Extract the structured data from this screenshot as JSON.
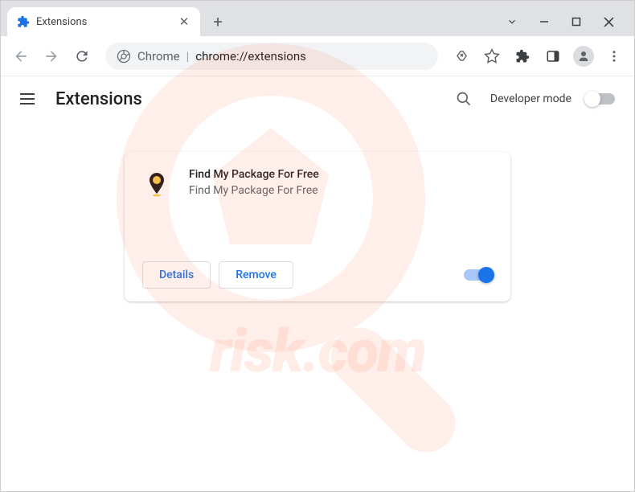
{
  "tab": {
    "title": "Extensions"
  },
  "url": {
    "prefix": "Chrome",
    "path": "chrome://extensions"
  },
  "header": {
    "title": "Extensions",
    "dev_mode_label": "Developer mode"
  },
  "extension": {
    "name": "Find My Package For Free",
    "description": "Find My Package For Free",
    "details_label": "Details",
    "remove_label": "Remove",
    "enabled": true
  },
  "watermark": {
    "text": "risk.com"
  }
}
